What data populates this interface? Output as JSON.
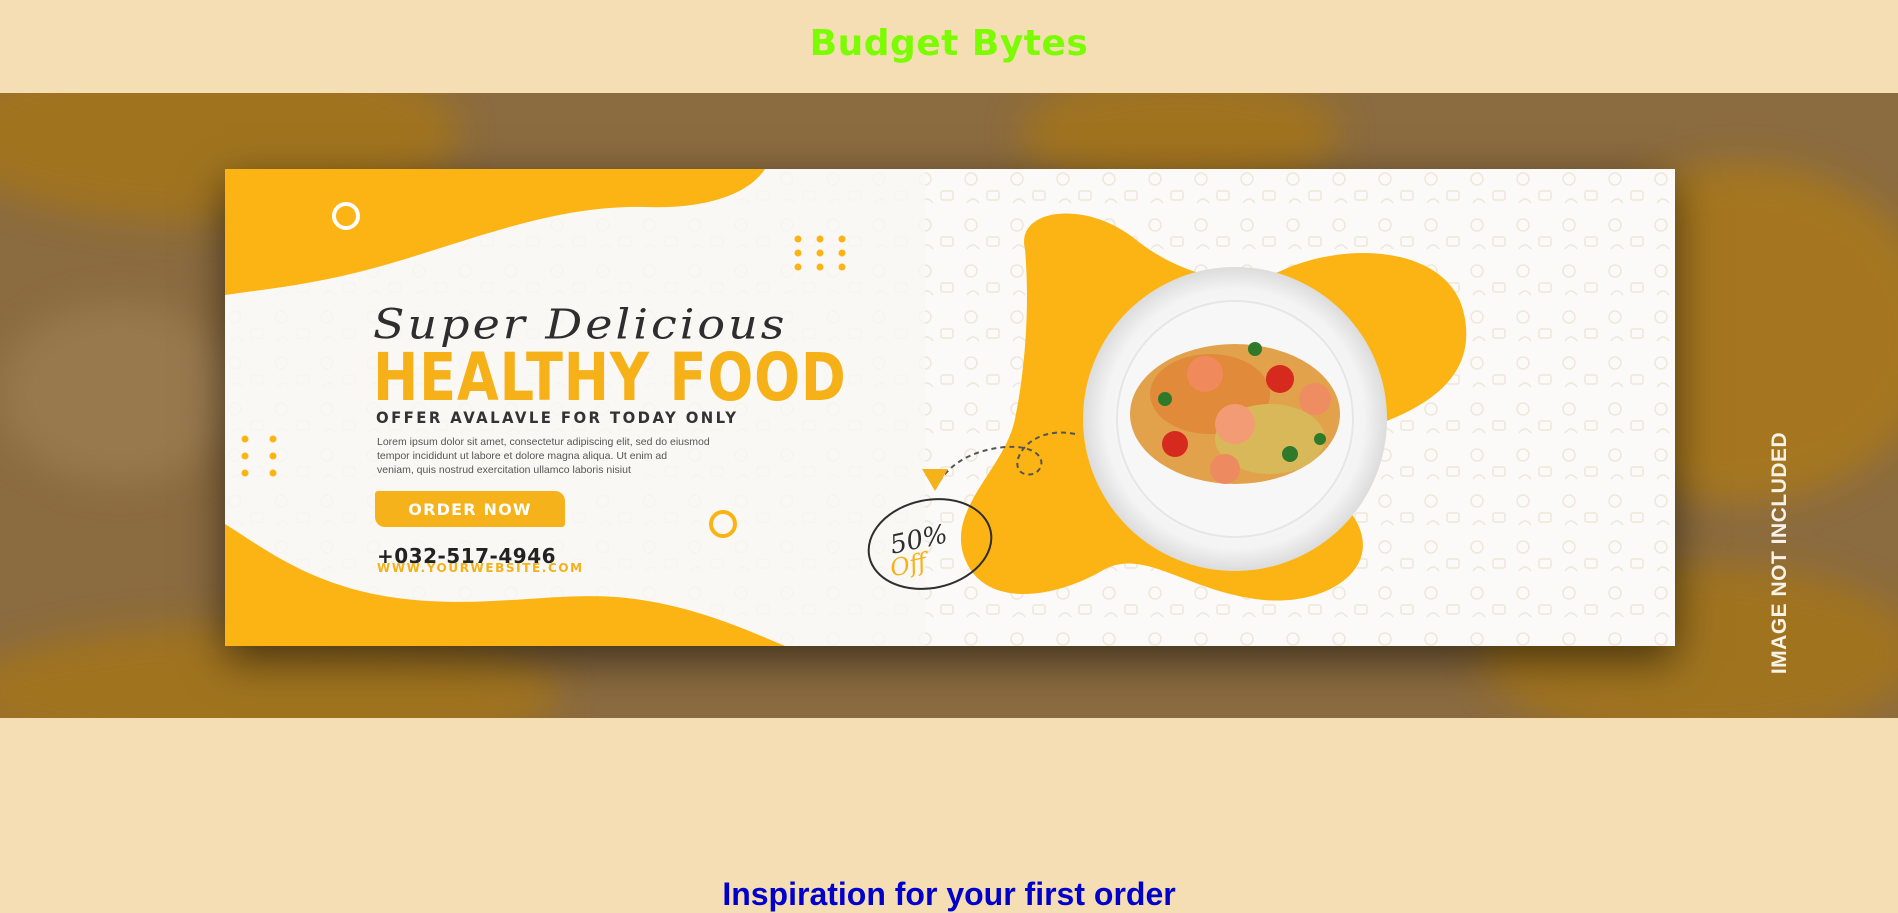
{
  "header": {
    "title": "Budget Bytes"
  },
  "hero": {
    "banner": {
      "script_title": "Super Delicious",
      "headline": "HEALTHY FOOD",
      "subhead": "OFFER AVALAVLE FOR TODAY ONLY",
      "body_lines": [
        "Lorem ipsum dolor sit amet, consectetur adipiscing elit, sed do eiusmod",
        "tempor incididunt ut labore et dolore magna aliqua. Ut enim ad",
        "veniam, quis nostrud exercitation ullamco laboris nisiut"
      ],
      "order_button": "ORDER NOW",
      "phone": "+032-517-4946",
      "website": "WWW.YOURWEBSITE.COM",
      "discount_pct": "50%",
      "discount_off": "Off"
    },
    "watermark": "IMAGE NOT INCLUDED"
  },
  "section": {
    "heading": "Inspiration for your first order"
  },
  "colors": {
    "page_bg": "#f5deb3",
    "title": "#7cfc00",
    "accent_yellow": "#f5b117",
    "heading_blue": "#0000cd"
  }
}
